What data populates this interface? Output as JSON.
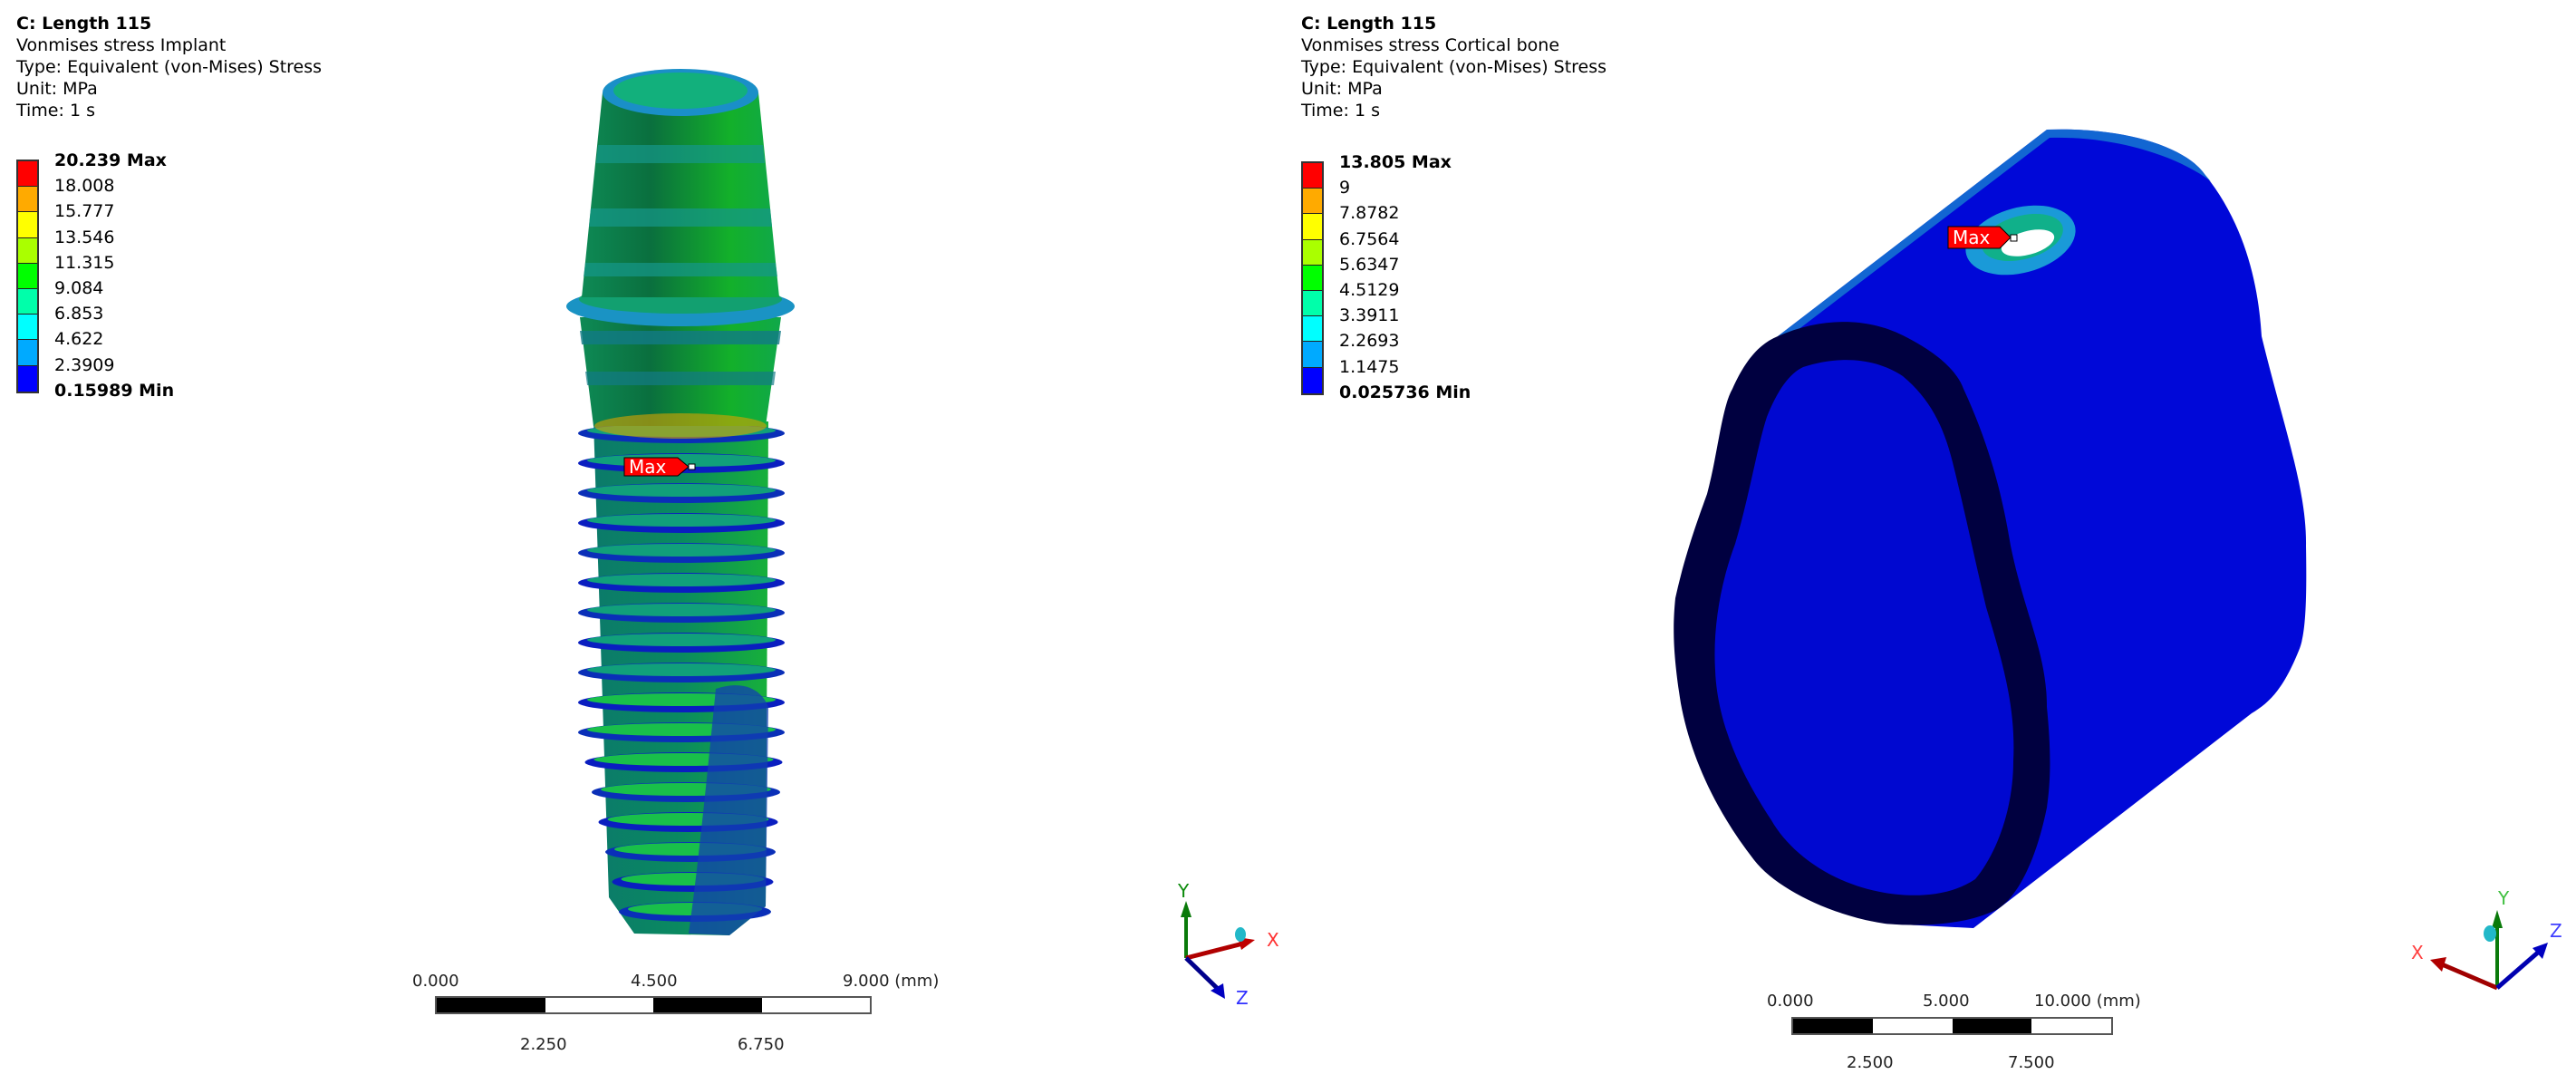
{
  "left_panel": {
    "title_lines": [
      "C: Length 115",
      "Vonmises stress Implant",
      "Type: Equivalent (von-Mises) Stress",
      "Unit: MPa",
      "Time: 1 s"
    ],
    "legend_labels": [
      "20.239 Max",
      "18.008",
      "15.777",
      "13.546",
      "11.315",
      "9.084",
      "6.853",
      "4.622",
      "2.3909",
      "0.15989 Min"
    ],
    "max_tag": "Max",
    "scale_top_labels": [
      "0.000",
      "4.500",
      "9.000 (mm)"
    ],
    "scale_bottom_labels": [
      "2.250",
      "6.750"
    ],
    "axes": {
      "x": "X",
      "y": "Y",
      "z": "Z"
    }
  },
  "right_panel": {
    "title_lines": [
      "C: Length 115",
      "Vonmises stress Cortical bone",
      "Type: Equivalent (von-Mises) Stress",
      "Unit: MPa",
      "Time: 1 s"
    ],
    "legend_labels": [
      "13.805 Max",
      "9",
      "7.8782",
      "6.7564",
      "5.6347",
      "4.5129",
      "3.3911",
      "2.2693",
      "1.1475",
      "0.025736 Min"
    ],
    "max_tag": "Max",
    "scale_top_labels": [
      "0.000",
      "5.000",
      "10.000 (mm)"
    ],
    "scale_bottom_labels": [
      "2.500",
      "7.500"
    ],
    "axes": {
      "x": "X",
      "y": "Y",
      "z": "Z"
    }
  },
  "colormap": [
    "#ff0000",
    "#ffaa00",
    "#ffff00",
    "#aaff00",
    "#00ff00",
    "#00ffaa",
    "#00ffff",
    "#00aaff",
    "#0000ff"
  ]
}
